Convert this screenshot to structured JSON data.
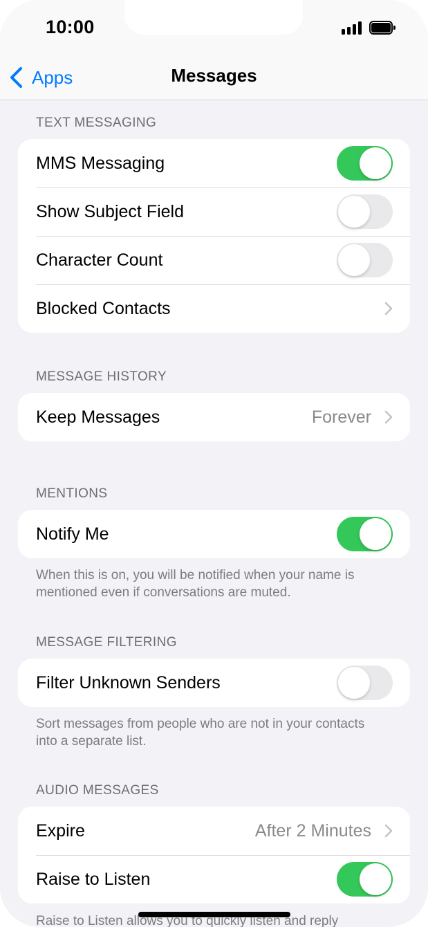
{
  "status_bar": {
    "time": "10:00"
  },
  "nav": {
    "back_label": "Apps",
    "title": "Messages"
  },
  "sections": {
    "text_messaging": {
      "header": "TEXT MESSAGING",
      "rows": {
        "mms": {
          "label": "MMS Messaging",
          "on": true
        },
        "subject": {
          "label": "Show Subject Field",
          "on": false
        },
        "char_count": {
          "label": "Character Count",
          "on": false
        },
        "blocked": {
          "label": "Blocked Contacts"
        }
      }
    },
    "message_history": {
      "header": "MESSAGE HISTORY",
      "rows": {
        "keep": {
          "label": "Keep Messages",
          "value": "Forever"
        }
      }
    },
    "mentions": {
      "header": "MENTIONS",
      "rows": {
        "notify": {
          "label": "Notify Me",
          "on": true
        }
      },
      "footer": "When this is on, you will be notified when your name is mentioned even if conversations are muted."
    },
    "message_filtering": {
      "header": "MESSAGE FILTERING",
      "rows": {
        "filter": {
          "label": "Filter Unknown Senders",
          "on": false
        }
      },
      "footer": "Sort messages from people who are not in your contacts into a separate list."
    },
    "audio_messages": {
      "header": "AUDIO MESSAGES",
      "rows": {
        "expire": {
          "label": "Expire",
          "value": "After 2 Minutes"
        },
        "raise": {
          "label": "Raise to Listen",
          "on": true
        }
      },
      "footer": "Raise to Listen allows you to quickly listen and reply"
    }
  },
  "colors": {
    "accent": "#007aff",
    "toggle_on": "#34c759",
    "toggle_off": "#e9e9eb",
    "background": "#f2f2f7"
  },
  "icons": [
    "chevron-left-icon",
    "chevron-right-icon",
    "signal-icon",
    "battery-icon"
  ]
}
